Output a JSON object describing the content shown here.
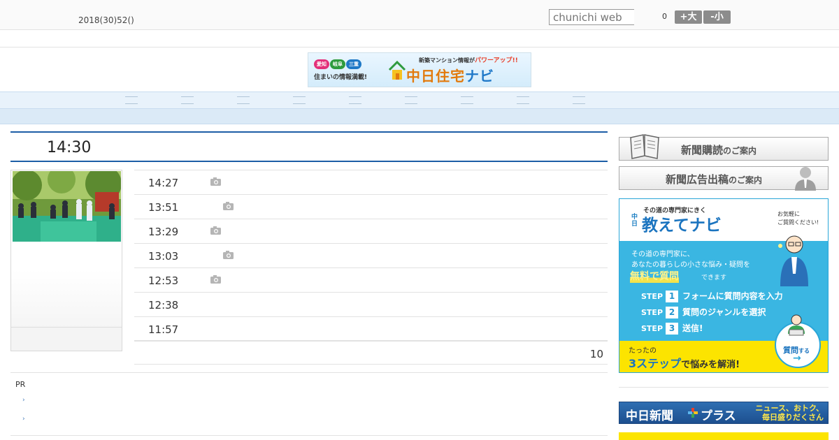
{
  "header": {
    "date": "2018(30)52()",
    "search_placeholder": "chunichi web",
    "font_size_count": "0",
    "font_large_label": "+大",
    "font_small_label": "-小"
  },
  "banner": {
    "region_pills": [
      "愛知",
      "岐阜",
      "三重"
    ],
    "tagline": "住まいの情報満載!",
    "top_copy": "新築マンション情報が",
    "top_copy_accent": "パワーアップ!!",
    "logo_main": "中日住宅",
    "logo_accent": "ナビ"
  },
  "nav": {
    "item_count": 9
  },
  "main": {
    "heading_time": "14:30",
    "news": [
      {
        "time": "14:27",
        "has_photo": true
      },
      {
        "time": "13:51",
        "has_photo": true
      },
      {
        "time": "13:29",
        "has_photo": true
      },
      {
        "time": "13:03",
        "has_photo": true
      },
      {
        "time": "12:53",
        "has_photo": true
      },
      {
        "time": "12:38",
        "has_photo": false
      },
      {
        "time": "11:57",
        "has_photo": false
      }
    ],
    "more_count": "10",
    "pr_label": "PR",
    "pr_bullet": "›"
  },
  "sidebar": {
    "subscribe": {
      "main": "新聞購読",
      "suffix": "のご案内"
    },
    "advertise": {
      "main": "新聞広告出稿",
      "suffix": "のご案内"
    },
    "ad": {
      "kicker": "その道の専門家にきく",
      "brand_prefix": "中日",
      "title": "教えてナビ",
      "note_line1": "お気軽に",
      "note_line2": "ご質問ください!",
      "lead_line1": "その道の専門家に、",
      "lead_line2": "あなたの暮らしの小さな悩み・疑問を",
      "free": "無料で質問",
      "free_tail": "できます",
      "step_word": "STEP",
      "steps": [
        {
          "num": "1",
          "text": "フォームに質問内容を入力"
        },
        {
          "num": "2",
          "text": "質問のジャンルを選択"
        },
        {
          "num": "3",
          "text": "送信!"
        }
      ],
      "bottom_line1": "たったの",
      "bottom_highlight": "3ステップ",
      "bottom_tail": "で悩みを解消!",
      "circle_label": "質問",
      "circle_suffix": "する",
      "circle_arrow": "→"
    },
    "plus_banner": {
      "left": "中日新聞",
      "right": "プラス",
      "tag_line1": "ニュース、おトク、",
      "tag_line2": "毎日盛りだくさん"
    }
  },
  "colors": {
    "nav_bg": "#e8f2fb",
    "heading_rule": "#1d5ea6",
    "ad_blue": "#3ab6e2",
    "ad_yellow": "#fce400"
  }
}
